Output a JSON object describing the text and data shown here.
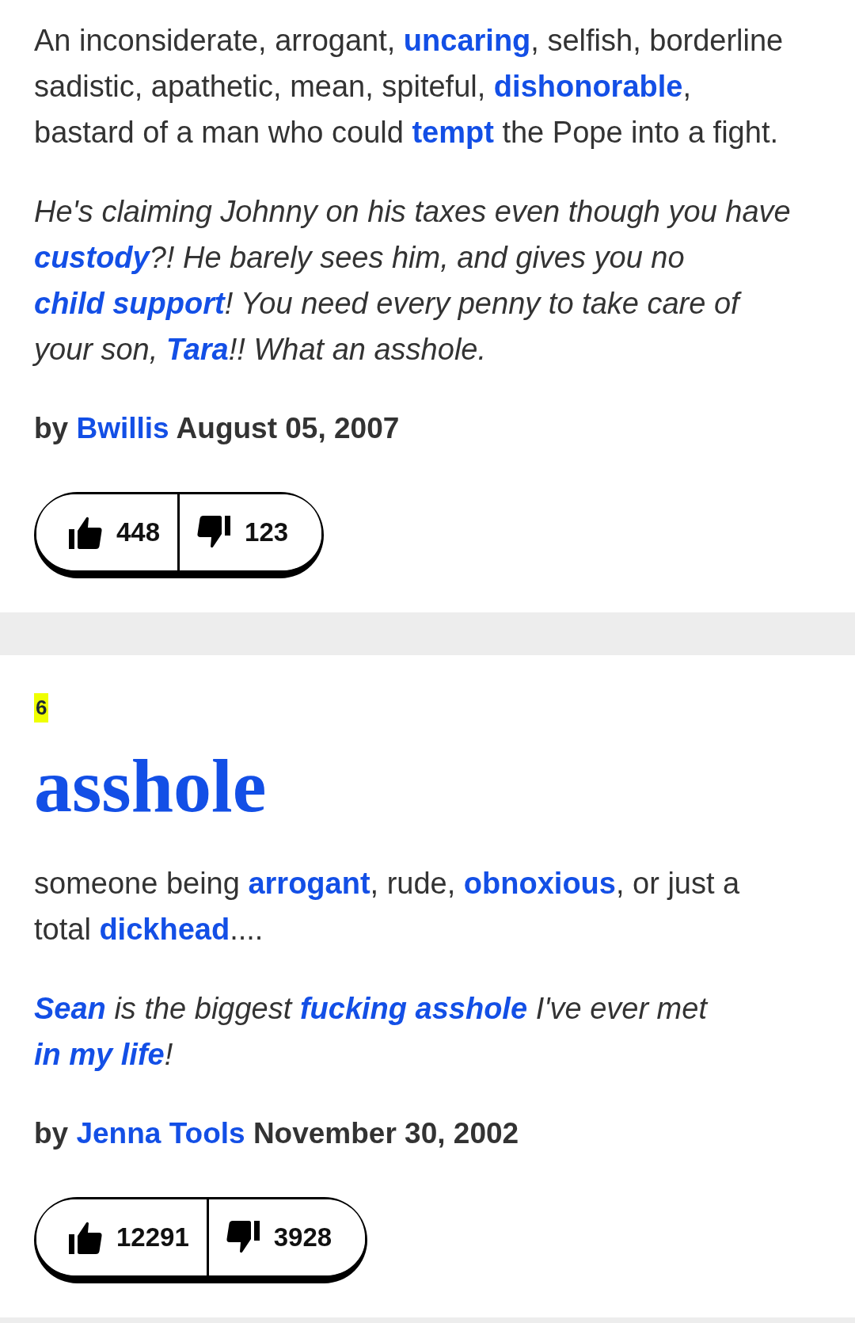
{
  "entries": [
    {
      "definition": [
        {
          "kind": "text",
          "text": "An inconsiderate, arrogant, "
        },
        {
          "kind": "link",
          "text": "uncaring"
        },
        {
          "kind": "text",
          "text": ", selfish, borderline sadistic, apathetic, mean, spiteful, "
        },
        {
          "kind": "link",
          "text": "dishonorable"
        },
        {
          "kind": "text",
          "text": ", bastard of a man who could "
        },
        {
          "kind": "link",
          "text": "tempt"
        },
        {
          "kind": "text",
          "text": " the Pope into a fight."
        }
      ],
      "example": [
        {
          "kind": "text",
          "text": "He's claiming Johnny on his taxes even though you have "
        },
        {
          "kind": "link",
          "text": "custody"
        },
        {
          "kind": "text",
          "text": "?! He barely sees him, and gives you no "
        },
        {
          "kind": "link",
          "text": "child support"
        },
        {
          "kind": "text",
          "text": "! You need every penny to take care of your son, "
        },
        {
          "kind": "link",
          "text": "Tara"
        },
        {
          "kind": "text",
          "text": "!! What an asshole."
        }
      ],
      "byline": {
        "prefix": "by",
        "author": "Bwillis",
        "date": "August 05, 2007"
      },
      "votes": {
        "up": "448",
        "down": "123"
      }
    },
    {
      "rank": "6",
      "word": "asshole",
      "definition": [
        {
          "kind": "text",
          "text": "someone being "
        },
        {
          "kind": "link",
          "text": "arrogant"
        },
        {
          "kind": "text",
          "text": ", rude, "
        },
        {
          "kind": "link",
          "text": "obnoxious"
        },
        {
          "kind": "text",
          "text": ", or just a total "
        },
        {
          "kind": "link",
          "text": "dickhead"
        },
        {
          "kind": "text",
          "text": "...."
        }
      ],
      "example": [
        {
          "kind": "link",
          "text": "Sean"
        },
        {
          "kind": "text",
          "text": " is the biggest "
        },
        {
          "kind": "link",
          "text": "fucking asshole"
        },
        {
          "kind": "text",
          "text": " I've ever met "
        },
        {
          "kind": "link",
          "text": "in my life"
        },
        {
          "kind": "text",
          "text": "!"
        }
      ],
      "byline": {
        "prefix": "by",
        "author": "Jenna Tools",
        "date": "November 30, 2002"
      },
      "votes": {
        "up": "12291",
        "down": "3928"
      }
    }
  ]
}
